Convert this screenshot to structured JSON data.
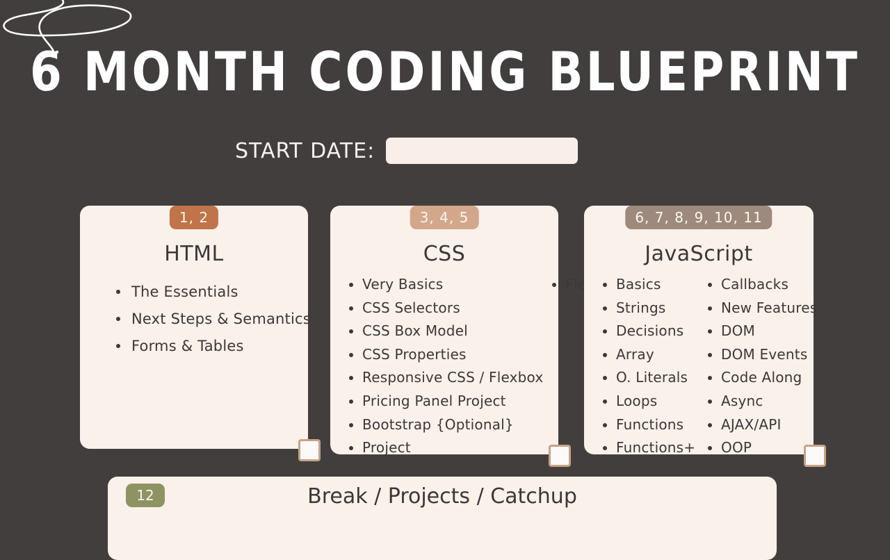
{
  "page": {
    "title": "6 MONTH CODING BLUEPRINT",
    "background_color": "#423e3e",
    "card_background_color": "#faf1ea",
    "text_color": "#3c3838",
    "decoration": "scribble-squiggle"
  },
  "start_date": {
    "label": "START DATE:",
    "value": "",
    "placeholder": ""
  },
  "cards": [
    {
      "badge": "1, 2",
      "badge_color": "#c1734a",
      "title": "HTML",
      "columns": [
        [
          "The Essentials",
          "Next Steps & Semantics",
          "Forms & Tables"
        ]
      ]
    },
    {
      "badge": "3, 4, 5",
      "badge_color": "#d3a78c",
      "title": "CSS",
      "columns": [
        [
          "Very Basics",
          "CSS Selectors",
          "CSS Box Model",
          "CSS Properties",
          "Responsive CSS / Flexbox",
          "Pricing Panel Project",
          "Bootstrap {Optional}",
          "Project"
        ],
        [
          "Flexbox"
        ]
      ]
    },
    {
      "badge": "6, 7, 8, 9, 10, 11",
      "badge_color": "#9d8a7c",
      "title": "JavaScript",
      "columns": [
        [
          "Basics",
          "Strings",
          "Decisions",
          "Array",
          "O. Literals",
          "Loops",
          "Functions",
          "Functions+"
        ],
        [
          "Callbacks",
          "New Features",
          "DOM",
          "DOM Events",
          "Code Along",
          "Async",
          "AJAX/API",
          "OOP"
        ]
      ]
    }
  ],
  "bottom_card": {
    "badge": "12",
    "badge_color": "#8d9362",
    "title": "Break / Projects / Catchup"
  }
}
